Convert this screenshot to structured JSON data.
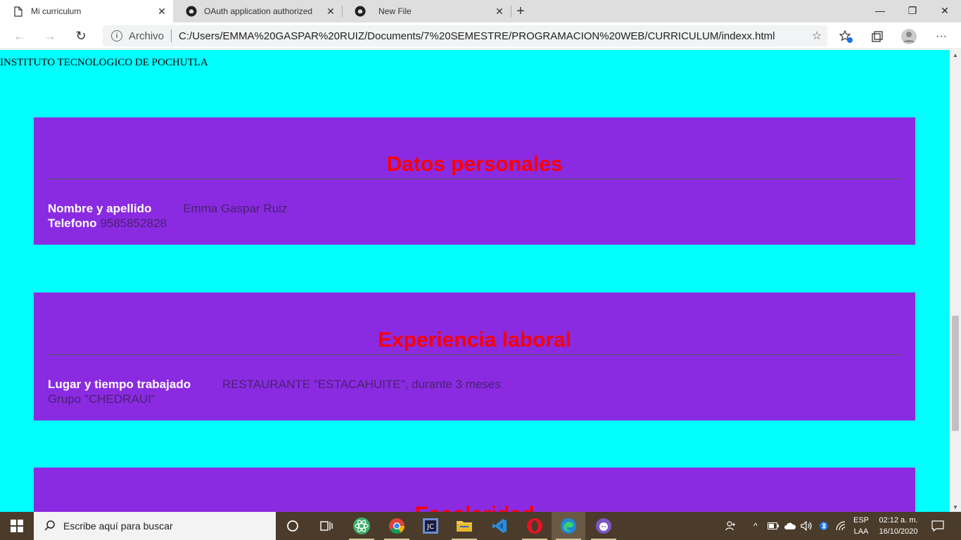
{
  "browser": {
    "tabs": [
      {
        "label": "Mi curriculum",
        "active": true
      },
      {
        "label": "OAuth application authorized",
        "active": false
      },
      {
        "label": "New File",
        "active": false
      }
    ],
    "address": {
      "scheme": "Archivo",
      "url": "C:/Users/EMMA%20GASPAR%20RUIZ/Documents/7%20SEMESTRE/PROGRAMACION%20WEB/CURRICULUM/indexx.html"
    },
    "window_controls": {
      "minimize": "—",
      "restore": "❐",
      "close": "✕"
    }
  },
  "page": {
    "institute": "INSTITUTO TECNOLOGICO DE POCHUTLA",
    "colors": {
      "background": "#00ffff",
      "section": "#8a2be2",
      "heading": "#ff0000"
    },
    "sections": [
      {
        "title": "Datos personales",
        "rows": [
          {
            "label": "Nombre y apellido",
            "value": "Emma Gaspar Ruiz"
          },
          {
            "label": "Telefono",
            "value": "9585852828"
          }
        ]
      },
      {
        "title": "Experiencia laboral",
        "rows": [
          {
            "label": "Lugar y tiempo trabajado",
            "value": "RESTAURANTE \"ESTACAHUITE\", durante 3 meses"
          },
          {
            "label": "",
            "value": "Grupo \"CHEDRAUI\""
          }
        ]
      },
      {
        "title": "Escolaridad",
        "rows": []
      }
    ]
  },
  "taskbar": {
    "search_placeholder": "Escribe aquí para buscar",
    "lang_top": "ESP",
    "lang_bottom": "LAA",
    "time": "02:12 a. m.",
    "date": "16/10/2020",
    "apps": [
      "task-view",
      "atom",
      "chrome",
      "jetbrains",
      "file-explorer",
      "vscode",
      "opera",
      "edge",
      "github-desktop"
    ]
  }
}
